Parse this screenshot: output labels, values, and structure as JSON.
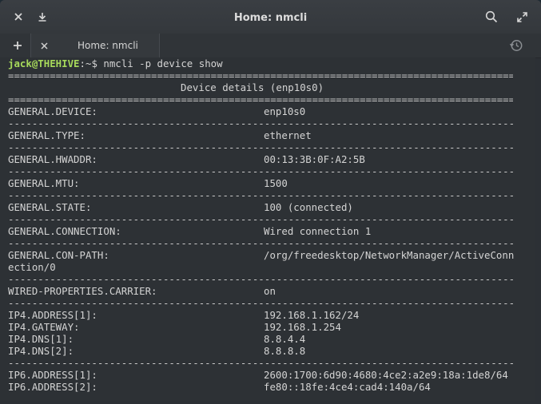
{
  "window": {
    "title": "Home: nmcli"
  },
  "tabs": [
    {
      "label": "Home: nmcli"
    }
  ],
  "terminal": {
    "prompt_user": "jack@THEHIVE",
    "prompt_rest": ":~$ ",
    "command": "nmcli -p device show",
    "header_rule": "=======================================================================================",
    "section_title": "Device details (enp10s0)",
    "dash_rule": "---------------------------------------------------------------------------------------",
    "rows": [
      {
        "key": "GENERAL.DEVICE:",
        "value": "enp10s0"
      },
      {
        "key": "GENERAL.TYPE:",
        "value": "ethernet"
      },
      {
        "key": "GENERAL.HWADDR:",
        "value": "00:13:3B:0F:A2:5B"
      },
      {
        "key": "GENERAL.MTU:",
        "value": "1500"
      },
      {
        "key": "GENERAL.STATE:",
        "value": "100 (connected)"
      },
      {
        "key": "GENERAL.CONNECTION:",
        "value": "Wired connection 1"
      },
      {
        "key": "GENERAL.CON-PATH:",
        "value": "/org/freedesktop/NetworkManager/ActiveConn",
        "wrap": "ection/0"
      },
      {
        "key": "WIRED-PROPERTIES.CARRIER:",
        "value": "on"
      }
    ],
    "ip4": [
      {
        "key": "IP4.ADDRESS[1]:",
        "value": "192.168.1.162/24"
      },
      {
        "key": "IP4.GATEWAY:",
        "value": "192.168.1.254"
      },
      {
        "key": "IP4.DNS[1]:",
        "value": "8.8.4.4"
      },
      {
        "key": "IP4.DNS[2]:",
        "value": "8.8.8.8"
      }
    ],
    "ip6": [
      {
        "key": "IP6.ADDRESS[1]:",
        "value": "2600:1700:6d90:4680:4ce2:a2e9:18a:1de8/64"
      },
      {
        "key": "IP6.ADDRESS[2]:",
        "value": "fe80::18fe:4ce4:cad4:140a/64"
      }
    ]
  }
}
